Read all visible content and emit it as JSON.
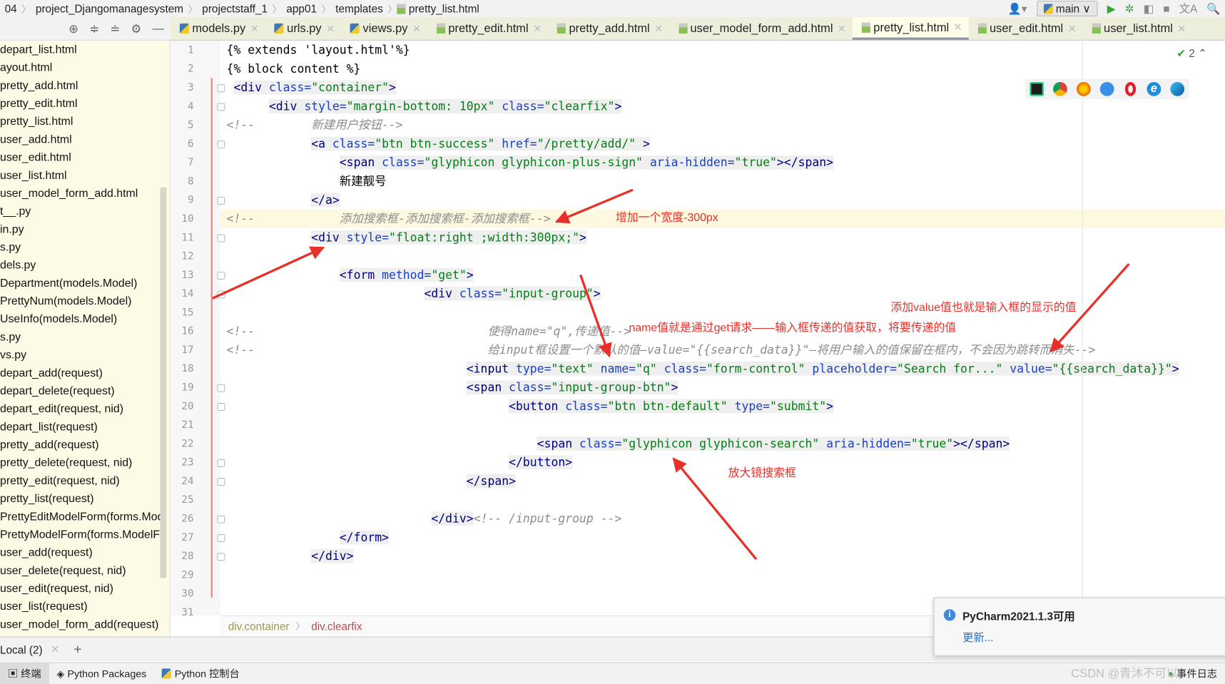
{
  "breadcrumb": [
    "04",
    "project_Djangomanagesystem",
    "projectstaff_1",
    "app01",
    "templates",
    "pretty_list.html"
  ],
  "toolbar": {
    "branch": "main",
    "translate_icon": "translate-icon",
    "search_icon": "search-icon"
  },
  "tabs": [
    {
      "label": "models.py",
      "type": "py"
    },
    {
      "label": "urls.py",
      "type": "py"
    },
    {
      "label": "views.py",
      "type": "py"
    },
    {
      "label": "pretty_edit.html",
      "type": "html"
    },
    {
      "label": "pretty_add.html",
      "type": "html"
    },
    {
      "label": "user_model_form_add.html",
      "type": "html"
    },
    {
      "label": "pretty_list.html",
      "type": "html",
      "active": true
    },
    {
      "label": "user_edit.html",
      "type": "html"
    },
    {
      "label": "user_list.html",
      "type": "html"
    }
  ],
  "sidebar": [
    "depart_list.html",
    "layout.html",
    "pretty_add.html",
    "pretty_edit.html",
    "pretty_list.html",
    "user_add.html",
    "user_edit.html",
    "user_list.html",
    "user_model_form_add.html",
    "__init__.py",
    "admin.py",
    "apps.py",
    "models.py",
    "Department(models.Model)",
    "PrettyNum(models.Model)",
    "UseInfo(models.Model)",
    "tests.py",
    "views.py",
    "depart_add(request)",
    "depart_delete(request)",
    "depart_edit(request, nid)",
    "depart_list(request)",
    "pretty_add(request)",
    "pretty_delete(request, nid)",
    "pretty_edit(request, nid)",
    "pretty_list(request)",
    "PrettyEditModelForm(forms.ModelForm)",
    "PrettyModelForm(forms.ModelForm)",
    "user_add(request)",
    "user_delete(request, nid)",
    "user_edit(request, nid)",
    "user_list(request)",
    "user_model_form_add(request)"
  ],
  "sidebar_visible": [
    "depart_list.html",
    "ayout.html",
    "pretty_add.html",
    "pretty_edit.html",
    "pretty_list.html",
    "user_add.html",
    "user_edit.html",
    "user_list.html",
    "user_model_form_add.html",
    "t__.py",
    "in.py",
    "s.py",
    "dels.py",
    "Department(models.Model)",
    "PrettyNum(models.Model)",
    "UseInfo(models.Model)",
    "s.py",
    "vs.py",
    "depart_add(request)",
    "depart_delete(request)",
    "depart_edit(request, nid)",
    "depart_list(request)",
    "pretty_add(request)",
    "pretty_delete(request, nid)",
    "pretty_edit(request, nid)",
    "pretty_list(request)",
    "PrettyEditModelForm(forms.Mod",
    "PrettyModelForm(forms.ModelFo",
    "user_add(request)",
    "user_delete(request, nid)",
    "user_edit(request, nid)",
    "user_list(request)",
    "user_model_form_add(request)"
  ],
  "inspections": "2",
  "code_lines": [
    [
      [
        "tx",
        "{% extends 'layout.html'%}"
      ]
    ],
    [
      [
        "tx",
        "{% block content %}"
      ]
    ],
    [
      [
        "sp",
        " "
      ],
      [
        "tag",
        "<div "
      ],
      [
        "attr",
        "class="
      ],
      [
        "val",
        "\"container\""
      ],
      [
        "tag",
        ">"
      ]
    ],
    [
      [
        "sp",
        "      "
      ],
      [
        "tag",
        "<div "
      ],
      [
        "attr",
        "style="
      ],
      [
        "val",
        "\"margin-bottom: 10px\" "
      ],
      [
        "attr",
        "class="
      ],
      [
        "val",
        "\"clearfix\""
      ],
      [
        "tag",
        ">"
      ]
    ],
    [
      [
        "cm",
        "<!--        新建用户按钮-->"
      ]
    ],
    [
      [
        "sp",
        "            "
      ],
      [
        "tag",
        "<a "
      ],
      [
        "attr",
        "class="
      ],
      [
        "val",
        "\"btn btn-success\" "
      ],
      [
        "attr",
        "href="
      ],
      [
        "val",
        "\"/pretty/add/\" "
      ],
      [
        "tag",
        ">"
      ]
    ],
    [
      [
        "sp",
        "                "
      ],
      [
        "tag",
        "<span "
      ],
      [
        "attr",
        "class="
      ],
      [
        "val",
        "\"glyphicon glyphicon-plus-sign\" "
      ],
      [
        "attr",
        "aria-hidden="
      ],
      [
        "val",
        "\"true\""
      ],
      [
        "tag",
        "></span>"
      ]
    ],
    [
      [
        "sp",
        "                "
      ],
      [
        "tx",
        "新建靓号"
      ]
    ],
    [
      [
        "sp",
        "            "
      ],
      [
        "tag",
        "</a>"
      ]
    ],
    [
      [
        "cm",
        "<!--            添加搜索框-添加搜索框-添加搜索框-->"
      ]
    ],
    [
      [
        "sp",
        "            "
      ],
      [
        "tag",
        "<div "
      ],
      [
        "attr",
        "style="
      ],
      [
        "val",
        "\"float:right ;width:300px;\""
      ],
      [
        "tag",
        ">"
      ]
    ],
    [],
    [
      [
        "sp",
        "                "
      ],
      [
        "tag",
        "<form "
      ],
      [
        "attr",
        "method="
      ],
      [
        "val",
        "\"get\""
      ],
      [
        "tag",
        ">"
      ]
    ],
    [
      [
        "sp",
        "                            "
      ],
      [
        "tag",
        "<div "
      ],
      [
        "attr",
        "class="
      ],
      [
        "val",
        "\"input-group\""
      ],
      [
        "tag",
        ">"
      ]
    ],
    [],
    [
      [
        "cm",
        "<!--                                 使得name=\"q\",传递值-->"
      ]
    ],
    [
      [
        "cm",
        "<!--                                 给input框设置一个默认的值—value=\"{{search_data}}\"—将用户输入的值保留在框内，不会因为跳转而消失-->"
      ]
    ],
    [
      [
        "sp",
        "                                  "
      ],
      [
        "tag",
        "<input "
      ],
      [
        "attr",
        "type="
      ],
      [
        "val",
        "\"text\" "
      ],
      [
        "attr",
        "name="
      ],
      [
        "val",
        "\"q\" "
      ],
      [
        "attr",
        "class="
      ],
      [
        "val",
        "\"form-control\" "
      ],
      [
        "attr",
        "placeholder="
      ],
      [
        "val",
        "\"Search for...\" "
      ],
      [
        "attr",
        "value="
      ],
      [
        "val",
        "\"{{search_data}}\""
      ],
      [
        "tag",
        ">"
      ]
    ],
    [
      [
        "sp",
        "                                  "
      ],
      [
        "tag",
        "<span "
      ],
      [
        "attr",
        "class="
      ],
      [
        "val",
        "\"input-group-btn\""
      ],
      [
        "tag",
        ">"
      ]
    ],
    [
      [
        "sp",
        "                                        "
      ],
      [
        "tag",
        "<button "
      ],
      [
        "attr",
        "class="
      ],
      [
        "val",
        "\"btn btn-default\" "
      ],
      [
        "attr",
        "type="
      ],
      [
        "val",
        "\"submit\""
      ],
      [
        "tag",
        ">"
      ]
    ],
    [],
    [
      [
        "sp",
        "                                            "
      ],
      [
        "tag",
        "<span "
      ],
      [
        "attr",
        "class="
      ],
      [
        "val",
        "\"glyphicon glyphicon-search\" "
      ],
      [
        "attr",
        "aria-hidden="
      ],
      [
        "val",
        "\"true\""
      ],
      [
        "tag",
        "></span>"
      ]
    ],
    [
      [
        "sp",
        "                                        "
      ],
      [
        "tag",
        "</button>"
      ]
    ],
    [
      [
        "sp",
        "                                  "
      ],
      [
        "tag",
        "</span>"
      ]
    ],
    [],
    [
      [
        "sp",
        "                             "
      ],
      [
        "tag",
        "</div>"
      ],
      [
        "cm",
        "<!-- /input-group -->"
      ]
    ],
    [
      [
        "sp",
        "                "
      ],
      [
        "tag",
        "</form>"
      ]
    ],
    [
      [
        "sp",
        "            "
      ],
      [
        "tag",
        "</div>"
      ]
    ],
    [],
    [],
    []
  ],
  "highlight_line": 10,
  "annotations": [
    {
      "text": "增加一个宽度-300px"
    },
    {
      "text": "name值就是通过get请求——输入框传递的值获取，将要传递的值"
    },
    {
      "text": "添加value值也就是输入框的显示的值"
    },
    {
      "text": "放大镜搜索框"
    }
  ],
  "annotation_color": "#e8302a",
  "editor_breadcrumb": [
    "div.container",
    "div.clearfix"
  ],
  "terminal": {
    "tab": "Local (2)",
    "add": "+"
  },
  "statusbar": [
    "终端",
    "Python Packages",
    "Python 控制台",
    "事件日志"
  ],
  "notification": {
    "title": "PyCharm2021.1.3可用",
    "link": "更新..."
  },
  "watermark": "CSDN @青沐不可以"
}
